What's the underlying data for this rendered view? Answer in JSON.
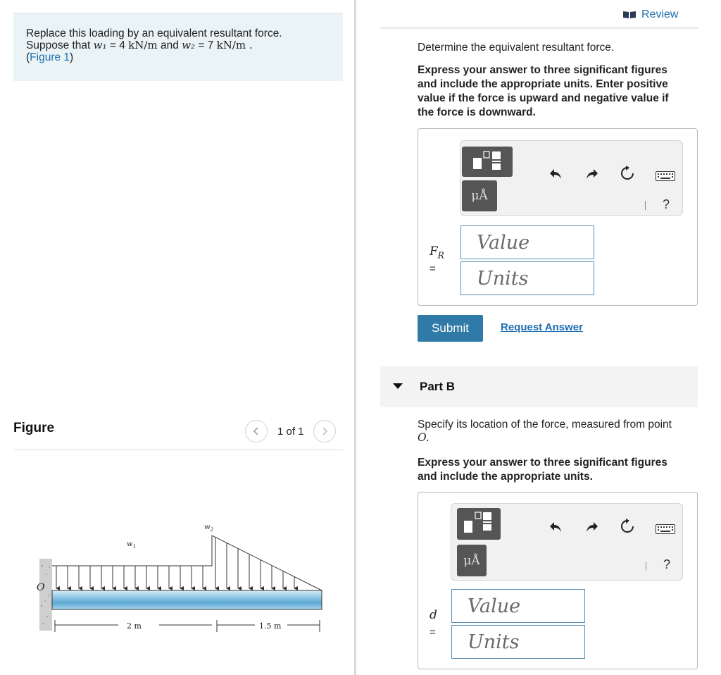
{
  "problem": {
    "line1": "Replace this loading by an equivalent resultant force.",
    "line2_pre": "Suppose that",
    "w1": "w₁",
    "w1_val": "= 4",
    "unit1": "kN/m",
    "and": "and",
    "w2": "w₂",
    "w2_val": "= 7",
    "unit2": "kN/m .",
    "figure_link_open": "(",
    "figure_link": "Figure 1",
    "figure_link_close": ")"
  },
  "figure": {
    "title": "Figure",
    "pager": "1 of 1",
    "labels": {
      "O": "O",
      "w1": "w",
      "w1_sub": "1",
      "w2": "w",
      "w2_sub": "2",
      "span1": "2 m",
      "span2": "1.5 m"
    }
  },
  "header": {
    "review": "Review"
  },
  "partA": {
    "prompt": "Determine the equivalent resultant force.",
    "instructions": [
      "Express your answer to three significant figures",
      "and include the appropriate units. Enter positive",
      "value if the force is upward and negative value if",
      "the force is downward."
    ],
    "variable": "F",
    "variable_sub": "R",
    "equals": "=",
    "value_placeholder": "Value",
    "units_placeholder": "Units",
    "units_button": "μÅ",
    "help": "?",
    "submit": "Submit",
    "request_answer": "Request Answer"
  },
  "partB": {
    "title": "Part B",
    "prompt_line1": "Specify its location of the force, measured from point",
    "prompt_line2": "O.",
    "instructions": [
      "Express your answer to three significant figures",
      "and include the appropriate units."
    ],
    "variable": "d",
    "equals": "=",
    "value_placeholder": "Value",
    "units_placeholder": "Units",
    "units_button": "μÅ",
    "help": "?"
  },
  "icons": {
    "undo": "undo-icon",
    "redo": "redo-icon",
    "reset": "reset-icon",
    "keyboard": "keyboard-icon",
    "templates": "templates-icon",
    "review": "book-icon"
  }
}
